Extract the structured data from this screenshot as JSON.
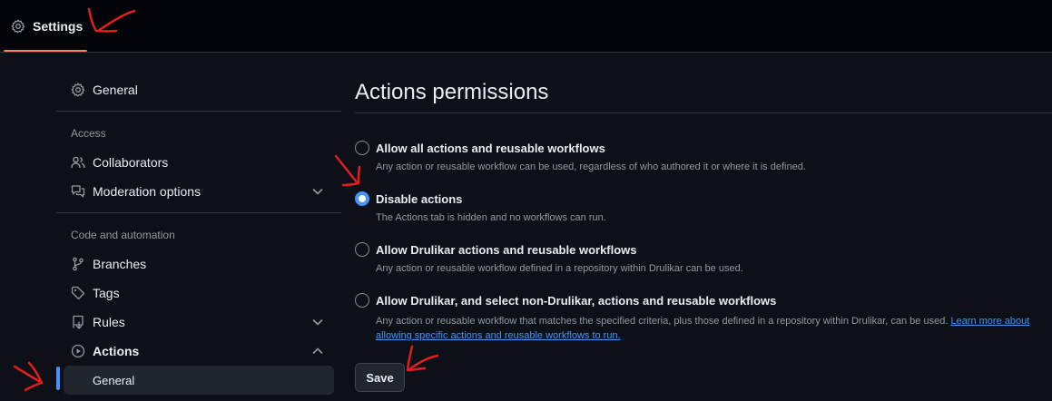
{
  "header": {
    "settings_tab": "Settings",
    "settings_icon": "gear-icon"
  },
  "sidebar": {
    "general": {
      "label": "General",
      "icon": "gear-icon"
    },
    "access_header": "Access",
    "collaborators": {
      "label": "Collaborators",
      "icon": "people-icon"
    },
    "moderation": {
      "label": "Moderation options",
      "icon": "comment-discussion-icon"
    },
    "code_header": "Code and automation",
    "branches": {
      "label": "Branches",
      "icon": "git-branch-icon"
    },
    "tags": {
      "label": "Tags",
      "icon": "tag-icon"
    },
    "rules": {
      "label": "Rules",
      "icon": "repo-push-icon"
    },
    "actions": {
      "label": "Actions",
      "icon": "play-icon"
    },
    "actions_general": {
      "label": "General"
    }
  },
  "main": {
    "title": "Actions permissions",
    "options": [
      {
        "label": "Allow all actions and reusable workflows",
        "desc": "Any action or reusable workflow can be used, regardless of who authored it or where it is defined.",
        "checked": false
      },
      {
        "label": "Disable actions",
        "desc": "The Actions tab is hidden and no workflows can run.",
        "checked": true
      },
      {
        "label": "Allow Drulikar actions and reusable workflows",
        "desc": "Any action or reusable workflow defined in a repository within Drulikar can be used.",
        "checked": false
      },
      {
        "label": "Allow Drulikar, and select non-Drulikar, actions and reusable workflows",
        "desc": "Any action or reusable workflow that matches the specified criteria, plus those defined in a repository within Drulikar, can be used.",
        "link": "Learn more about allowing specific actions and reusable workflows to run.",
        "checked": false
      }
    ],
    "save_label": "Save"
  },
  "colors": {
    "accent": "#4493f8",
    "tab_underline": "#f78166",
    "annotation": "#e01e1e"
  }
}
